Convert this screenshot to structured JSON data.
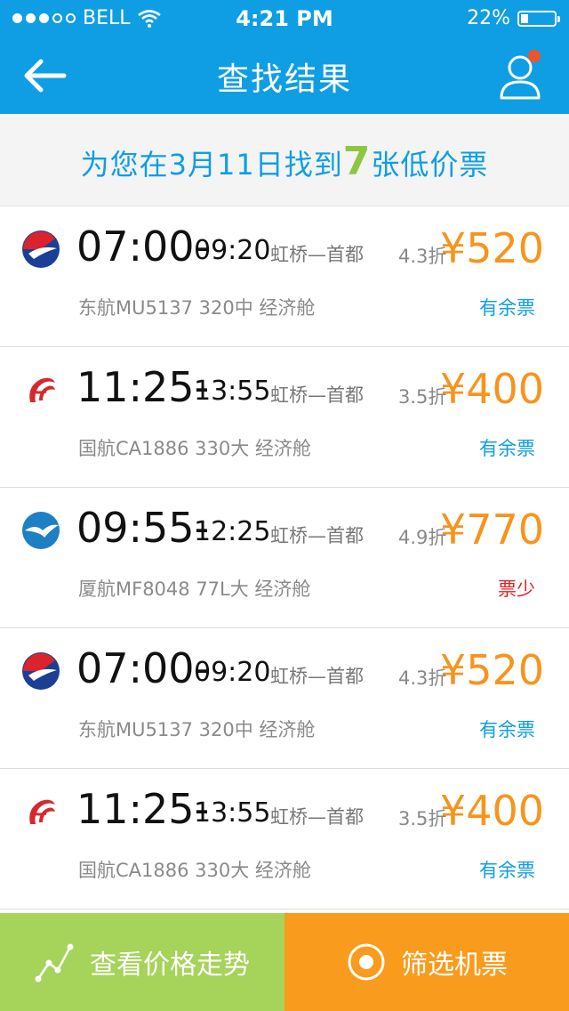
{
  "status_bar": {
    "carrier": "BELL",
    "time": "4:21 PM",
    "battery": "22%",
    "battery_level": 0.22
  },
  "nav": {
    "title": "查找结果"
  },
  "summary": {
    "prefix": "为您在3月11日找到",
    "count": "7",
    "suffix": "张低价票"
  },
  "flights": [
    {
      "airline_icon": "china-eastern-logo",
      "dep": "07:00-",
      "arr": "09:20",
      "route": "虹桥—首都",
      "discount": "4.3折",
      "price": "¥520",
      "flight_info": "东航MU5137  320中  经济舱",
      "availability": "有余票",
      "low": false
    },
    {
      "airline_icon": "air-china-logo",
      "dep": "11:25-",
      "arr": "13:55",
      "route": "虹桥—首都",
      "discount": "3.5折",
      "price": "¥400",
      "flight_info": "国航CA1886  330大  经济舱",
      "availability": "有余票",
      "low": false
    },
    {
      "airline_icon": "xiamen-airlines-logo",
      "dep": "09:55-",
      "arr": "12:25",
      "route": "虹桥—首都",
      "discount": "4.9折",
      "price": "¥770",
      "flight_info": "厦航MF8048  77L大  经济舱",
      "availability": "票少",
      "low": true
    },
    {
      "airline_icon": "china-eastern-logo",
      "dep": "07:00-",
      "arr": "09:20",
      "route": "虹桥—首都",
      "discount": "4.3折",
      "price": "¥520",
      "flight_info": "东航MU5137  320中  经济舱",
      "availability": "有余票",
      "low": false
    },
    {
      "airline_icon": "air-china-logo",
      "dep": "11:25-",
      "arr": "13:55",
      "route": "虹桥—首都",
      "discount": "3.5折",
      "price": "¥400",
      "flight_info": "国航CA1886  330大  经济舱",
      "availability": "有余票",
      "low": false
    }
  ],
  "bottom": {
    "trend_label": "查看价格走势",
    "filter_label": "筛选机票"
  },
  "colors": {
    "primary": "#0f9ee3",
    "price": "#f7941d",
    "count": "#8dc63f",
    "low": "#e02020",
    "trend_bg": "#a6d35a",
    "filter_bg": "#f99b1c"
  }
}
